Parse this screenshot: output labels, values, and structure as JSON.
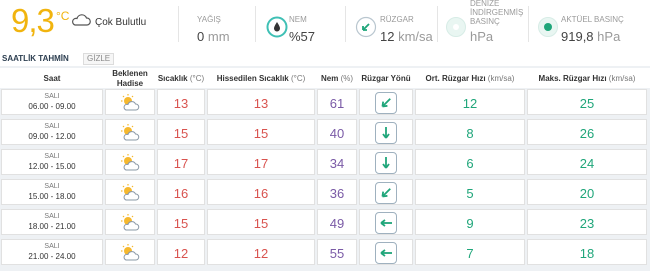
{
  "current": {
    "temp": "9,3",
    "deg": "°C",
    "condition": "Çok Bulutlu",
    "cloud_icon": "cloud-icon"
  },
  "metrics": {
    "rain": {
      "label": "YAĞIŞ",
      "value": "0",
      "unit": "mm"
    },
    "humidity": {
      "label": "NEM",
      "value": "%57",
      "icon": "drop-icon"
    },
    "wind": {
      "label": "RÜZGAR",
      "value": "12",
      "unit": "km/sa",
      "icon": "wind-arrow-icon"
    },
    "reduced_pressure": {
      "label1": "DENİZE",
      "label2": "İNDİRGENMİŞ",
      "label3": "BASINÇ",
      "unit": "hPa"
    },
    "pressure": {
      "label": "AKTÜEL BASINÇ",
      "value": "919,8",
      "unit": "hPa"
    }
  },
  "section": {
    "title": "SAATLİK TAHMİN",
    "toggle": "GİZLE"
  },
  "columns": {
    "saat": "Saat",
    "hadise1": "Beklenen",
    "hadise2": "Hadise",
    "sicaklik": "Sıcaklık",
    "sicaklik_unit": "(°C)",
    "hissedilen": "Hissedilen Sıcaklık",
    "hissedilen_unit": "(°C)",
    "nem": "Nem",
    "nem_unit": "(%)",
    "yon": "Rüzgar Yönü",
    "ort": "Ort. Rüzgar Hızı",
    "ort_unit": "(km/sa)",
    "maks": "Maks. Rüzgar Hızı",
    "maks_unit": "(km/sa)"
  },
  "rows": [
    {
      "day": "SALI",
      "time": "06.00 - 09.00",
      "temp": "13",
      "feels": "13",
      "humidity": "61",
      "dir": "wsw",
      "avg": "12",
      "max": "25"
    },
    {
      "day": "SALI",
      "time": "09.00 - 12.00",
      "temp": "15",
      "feels": "15",
      "humidity": "40",
      "dir": "s",
      "avg": "8",
      "max": "26"
    },
    {
      "day": "SALI",
      "time": "12.00 - 15.00",
      "temp": "17",
      "feels": "17",
      "humidity": "34",
      "dir": "s",
      "avg": "6",
      "max": "24"
    },
    {
      "day": "SALI",
      "time": "15.00 - 18.00",
      "temp": "16",
      "feels": "16",
      "humidity": "36",
      "dir": "wsw",
      "avg": "5",
      "max": "20"
    },
    {
      "day": "SALI",
      "time": "18.00 - 21.00",
      "temp": "15",
      "feels": "15",
      "humidity": "49",
      "dir": "w",
      "avg": "9",
      "max": "23"
    },
    {
      "day": "SALI",
      "time": "21.00 - 24.00",
      "temp": "12",
      "feels": "12",
      "humidity": "55",
      "dir": "w",
      "avg": "7",
      "max": "18"
    }
  ]
}
